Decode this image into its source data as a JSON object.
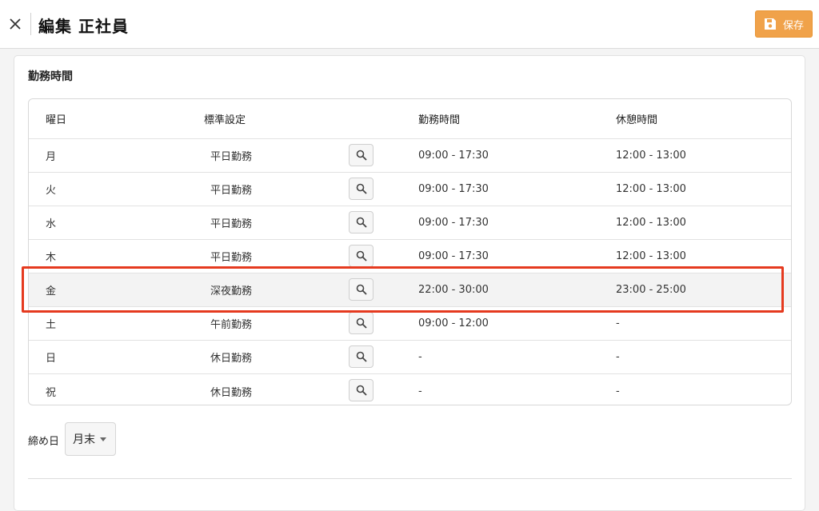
{
  "header": {
    "title": "編集 正社員",
    "save_label": "保存",
    "accent_color": "#f0a24a"
  },
  "section": {
    "title": "勤務時間"
  },
  "table": {
    "columns": {
      "day": "曜日",
      "standard": "標準設定",
      "work": "勤務時間",
      "break": "休憩時間"
    },
    "rows": [
      {
        "day": "月",
        "standard": "平日勤務",
        "work": "09:00 - 17:30",
        "break": "12:00 - 13:00"
      },
      {
        "day": "火",
        "standard": "平日勤務",
        "work": "09:00 - 17:30",
        "break": "12:00 - 13:00"
      },
      {
        "day": "水",
        "standard": "平日勤務",
        "work": "09:00 - 17:30",
        "break": "12:00 - 13:00"
      },
      {
        "day": "木",
        "standard": "平日勤務",
        "work": "09:00 - 17:30",
        "break": "12:00 - 13:00"
      },
      {
        "day": "金",
        "standard": "深夜勤務",
        "work": "22:00 - 30:00",
        "break": "23:00 - 25:00"
      },
      {
        "day": "土",
        "standard": "午前勤務",
        "work": "09:00 - 12:00",
        "break": "-"
      },
      {
        "day": "日",
        "standard": "休日勤務",
        "work": "-",
        "break": "-"
      },
      {
        "day": "祝",
        "standard": "休日勤務",
        "work": "-",
        "break": "-"
      }
    ],
    "highlight_color": "#e53a1f"
  },
  "closing": {
    "label": "締め日",
    "value": "月末"
  },
  "icons": {
    "close": "close-icon",
    "save": "floppy-disk-icon",
    "search": "magnifier-icon",
    "dropdown": "caret-down-icon"
  }
}
